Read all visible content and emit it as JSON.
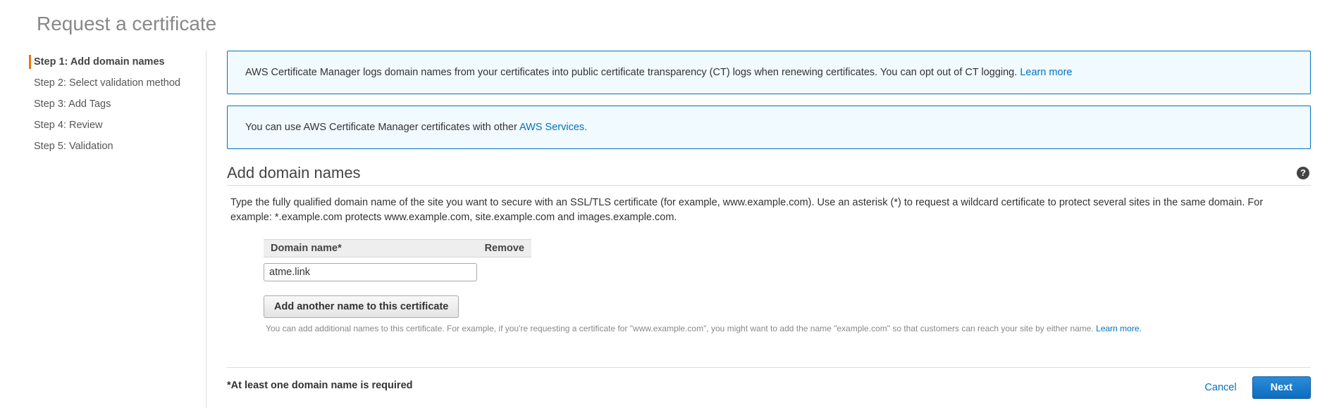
{
  "page": {
    "title": "Request a certificate"
  },
  "sidebar": {
    "steps": [
      {
        "label": "Step 1: Add domain names",
        "active": true
      },
      {
        "label": "Step 2: Select validation method",
        "active": false
      },
      {
        "label": "Step 3: Add Tags",
        "active": false
      },
      {
        "label": "Step 4: Review",
        "active": false
      },
      {
        "label": "Step 5: Validation",
        "active": false
      }
    ]
  },
  "info": {
    "ct_text": "AWS Certificate Manager logs domain names from your certificates into public certificate transparency (CT) logs when renewing certificates. You can opt out of CT logging.",
    "ct_link": "Learn more",
    "services_text": "You can use AWS Certificate Manager certificates with other",
    "services_link": "AWS Services."
  },
  "section": {
    "title": "Add domain names",
    "help_icon": "?",
    "description": "Type the fully qualified domain name of the site you want to secure with an SSL/TLS certificate (for example, www.example.com). Use an asterisk (*) to request a wildcard certificate to protect several sites in the same domain. For example: *.example.com protects www.example.com, site.example.com and images.example.com."
  },
  "table": {
    "col_domain": "Domain name*",
    "col_remove": "Remove",
    "domain_value": "atme.link"
  },
  "add_button": {
    "label": "Add another name to this certificate"
  },
  "hint": {
    "text": "You can add additional names to this certificate. For example, if you're requesting a certificate for \"www.example.com\", you might want to add the name \"example.com\" so that customers can reach your site by either name.",
    "link": "Learn more."
  },
  "footer": {
    "required_note": "*At least one domain name is required",
    "cancel_label": "Cancel",
    "next_label": "Next"
  },
  "colors": {
    "accent": "#ec7211",
    "link": "#0073bb",
    "info_bg": "#f1faff",
    "primary_button": "#1a73c8"
  }
}
